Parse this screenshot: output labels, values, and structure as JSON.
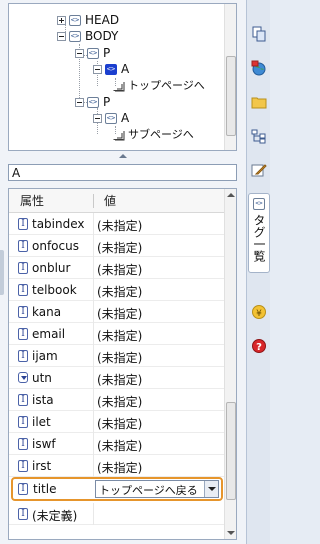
{
  "tree": {
    "nodes": [
      {
        "label": "HEAD"
      },
      {
        "label": "BODY"
      },
      {
        "label": "P"
      },
      {
        "label": "A"
      },
      {
        "label": "トップページへ"
      },
      {
        "label": "P"
      },
      {
        "label": "A"
      },
      {
        "label": "サブページへ"
      }
    ]
  },
  "filter": {
    "value": "A"
  },
  "grid": {
    "header": {
      "col1": "属性",
      "col2": "値"
    },
    "rows": [
      {
        "name": "tabindex",
        "value": "(未指定)",
        "icon": "text-attr-icon"
      },
      {
        "name": "onfocus",
        "value": "(未指定)",
        "icon": "text-attr-icon"
      },
      {
        "name": "onblur",
        "value": "(未指定)",
        "icon": "text-attr-icon"
      },
      {
        "name": "telbook",
        "value": "(未指定)",
        "icon": "text-attr-icon"
      },
      {
        "name": "kana",
        "value": "(未指定)",
        "icon": "text-attr-icon"
      },
      {
        "name": "email",
        "value": "(未指定)",
        "icon": "text-attr-icon"
      },
      {
        "name": "ijam",
        "value": "(未指定)",
        "icon": "text-attr-icon"
      },
      {
        "name": "utn",
        "value": "(未指定)",
        "icon": "dropdown-attr-icon"
      },
      {
        "name": "ista",
        "value": "(未指定)",
        "icon": "text-attr-icon"
      },
      {
        "name": "ilet",
        "value": "(未指定)",
        "icon": "text-attr-icon"
      },
      {
        "name": "iswf",
        "value": "(未指定)",
        "icon": "text-attr-icon"
      },
      {
        "name": "irst",
        "value": "(未指定)",
        "icon": "text-attr-icon"
      }
    ],
    "selected": {
      "name": "title",
      "value": "トップページへ戻る"
    },
    "last_row": {
      "name": "(未定義)",
      "value": ""
    }
  },
  "strip": {
    "tag_list_label": "タグ一覧"
  },
  "colors": {
    "selection_border": "#e6952c",
    "selected_tag": "#1b3fcf",
    "panel_border": "#9aa9bf"
  }
}
